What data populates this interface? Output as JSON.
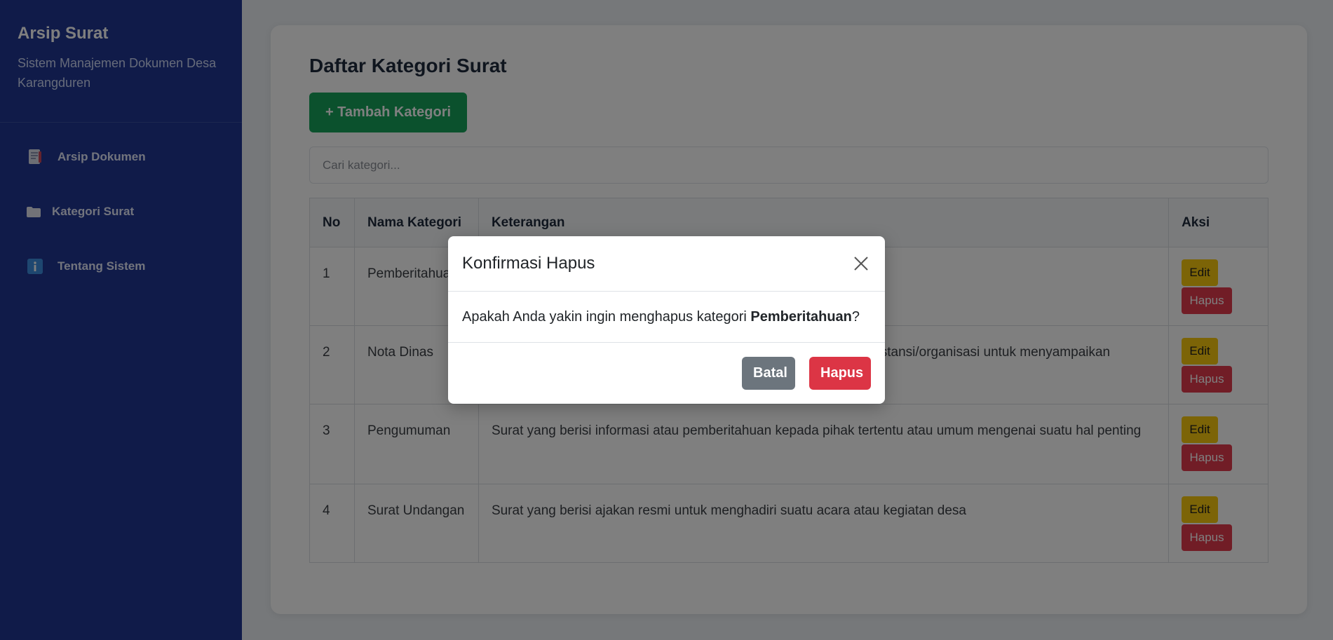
{
  "sidebar": {
    "title": "Arsip Surat",
    "subtitle": "Sistem Manajemen Dokumen Desa Karangduren",
    "items": [
      {
        "label": "Arsip Dokumen",
        "icon": "document-icon"
      },
      {
        "label": "Kategori Surat",
        "icon": "folder-icon"
      },
      {
        "label": "Tentang Sistem",
        "icon": "info-icon"
      }
    ]
  },
  "main": {
    "title": "Daftar Kategori Surat",
    "add_button": "+ Tambah Kategori",
    "search_placeholder": "Cari kategori...",
    "table": {
      "headers": [
        "No",
        "Nama Kategori",
        "Keterangan",
        "Aksi"
      ],
      "rows": [
        {
          "no": "1",
          "name": "Pemberitahuan",
          "desc": "",
          "edit": "Edit",
          "delete": "Hapus"
        },
        {
          "no": "2",
          "name": "Nota Dinas",
          "desc": "instansi/organisasi untuk menyampaikan",
          "edit": "Edit",
          "delete": "Hapus"
        },
        {
          "no": "3",
          "name": "Pengumuman",
          "desc": "Surat yang berisi informasi atau pemberitahuan kepada pihak tertentu atau umum mengenai suatu hal penting",
          "edit": "Edit",
          "delete": "Hapus"
        },
        {
          "no": "4",
          "name": "Surat Undangan",
          "desc": "Surat yang berisi ajakan resmi untuk menghadiri suatu acara atau kegiatan desa",
          "edit": "Edit",
          "delete": "Hapus"
        }
      ]
    }
  },
  "modal": {
    "title": "Konfirmasi Hapus",
    "message_prefix": "Apakah Anda yakin ingin menghapus kategori ",
    "message_target": "Pemberitahuan",
    "message_suffix": "?",
    "cancel_label": "Batal",
    "confirm_label": "Hapus"
  },
  "colors": {
    "sidebar_bg": "#203792",
    "add_button": "#16a35b",
    "edit_button": "#f9c80e",
    "delete_button": "#e23a4c",
    "cancel_button": "#6c757d"
  }
}
